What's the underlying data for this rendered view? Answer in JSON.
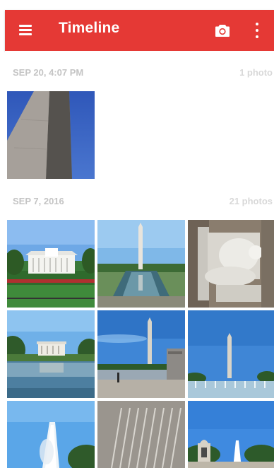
{
  "app_bar": {
    "title": "Timeline",
    "background_color": "#e53935",
    "menu_icon": "hamburger-menu-icon",
    "camera_icon": "camera-icon",
    "overflow_icon": "more-vertical-icon"
  },
  "sections": [
    {
      "date": "SEP 20, 4:07 PM",
      "count": "1 photo",
      "photos": [
        {
          "subject": "washington-monument-closeup"
        }
      ]
    },
    {
      "date": "SEP 7, 2016",
      "count": "21 photos",
      "photos": [
        {
          "subject": "white-house"
        },
        {
          "subject": "reflecting-pool-monument"
        },
        {
          "subject": "lincoln-statue"
        },
        {
          "subject": "lincoln-memorial"
        },
        {
          "subject": "monument-fountain"
        },
        {
          "subject": "monument-plaza"
        },
        {
          "subject": "fountain-jet"
        },
        {
          "subject": "stone-inscription"
        },
        {
          "subject": "wwii-memorial"
        }
      ]
    }
  ]
}
